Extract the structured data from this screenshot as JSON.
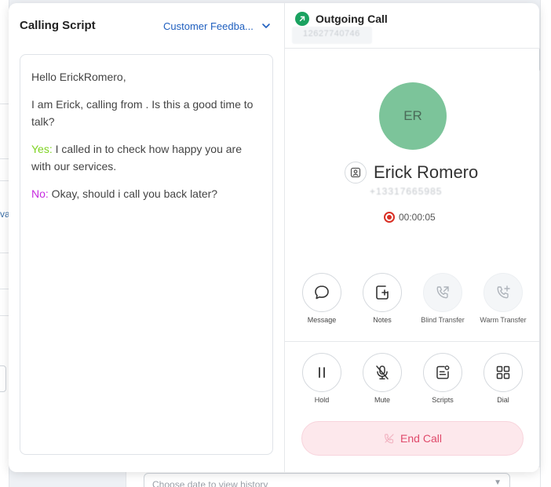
{
  "background": {
    "left_fragment": "va",
    "date_select_placeholder": "Choose date to view history"
  },
  "script_panel": {
    "title": "Calling Script",
    "selected_script": "Customer Feedba...",
    "lines": {
      "greeting": "Hello ErickRomero,",
      "intro": "I am Erick, calling from . Is this a good time to talk?",
      "yes_label": "Yes:",
      "yes_text": " I called in to check how happy you are with our services.",
      "no_label": "No:",
      "no_text": " Okay, should i call you back later?"
    }
  },
  "call_panel": {
    "title": "Outgoing Call",
    "from_number": "12627740746",
    "avatar_initials": "ER",
    "contact_name": "Erick Romero",
    "contact_phone": "+13317665985",
    "timer": "00:00:05",
    "actions_row1": [
      {
        "label": "Message",
        "icon": "message-icon"
      },
      {
        "label": "Notes",
        "icon": "notes-icon"
      },
      {
        "label": "Blind Transfer",
        "icon": "blind-transfer-icon"
      },
      {
        "label": "Warm Transfer",
        "icon": "warm-transfer-icon"
      }
    ],
    "actions_row2": [
      {
        "label": "Hold",
        "icon": "pause-icon"
      },
      {
        "label": "Mute",
        "icon": "mic-off-icon"
      },
      {
        "label": "Scripts",
        "icon": "scripts-icon"
      },
      {
        "label": "Dial",
        "icon": "dialpad-icon"
      }
    ],
    "end_call_label": "End Call"
  },
  "colors": {
    "accent_green": "#1aa260",
    "avatar_bg": "#7cc49a",
    "yes": "#7ed321",
    "no": "#c72ae0",
    "end_call_text": "#e04a6b",
    "end_call_bg": "#fde8ec",
    "link_blue": "#1f5fbf"
  }
}
